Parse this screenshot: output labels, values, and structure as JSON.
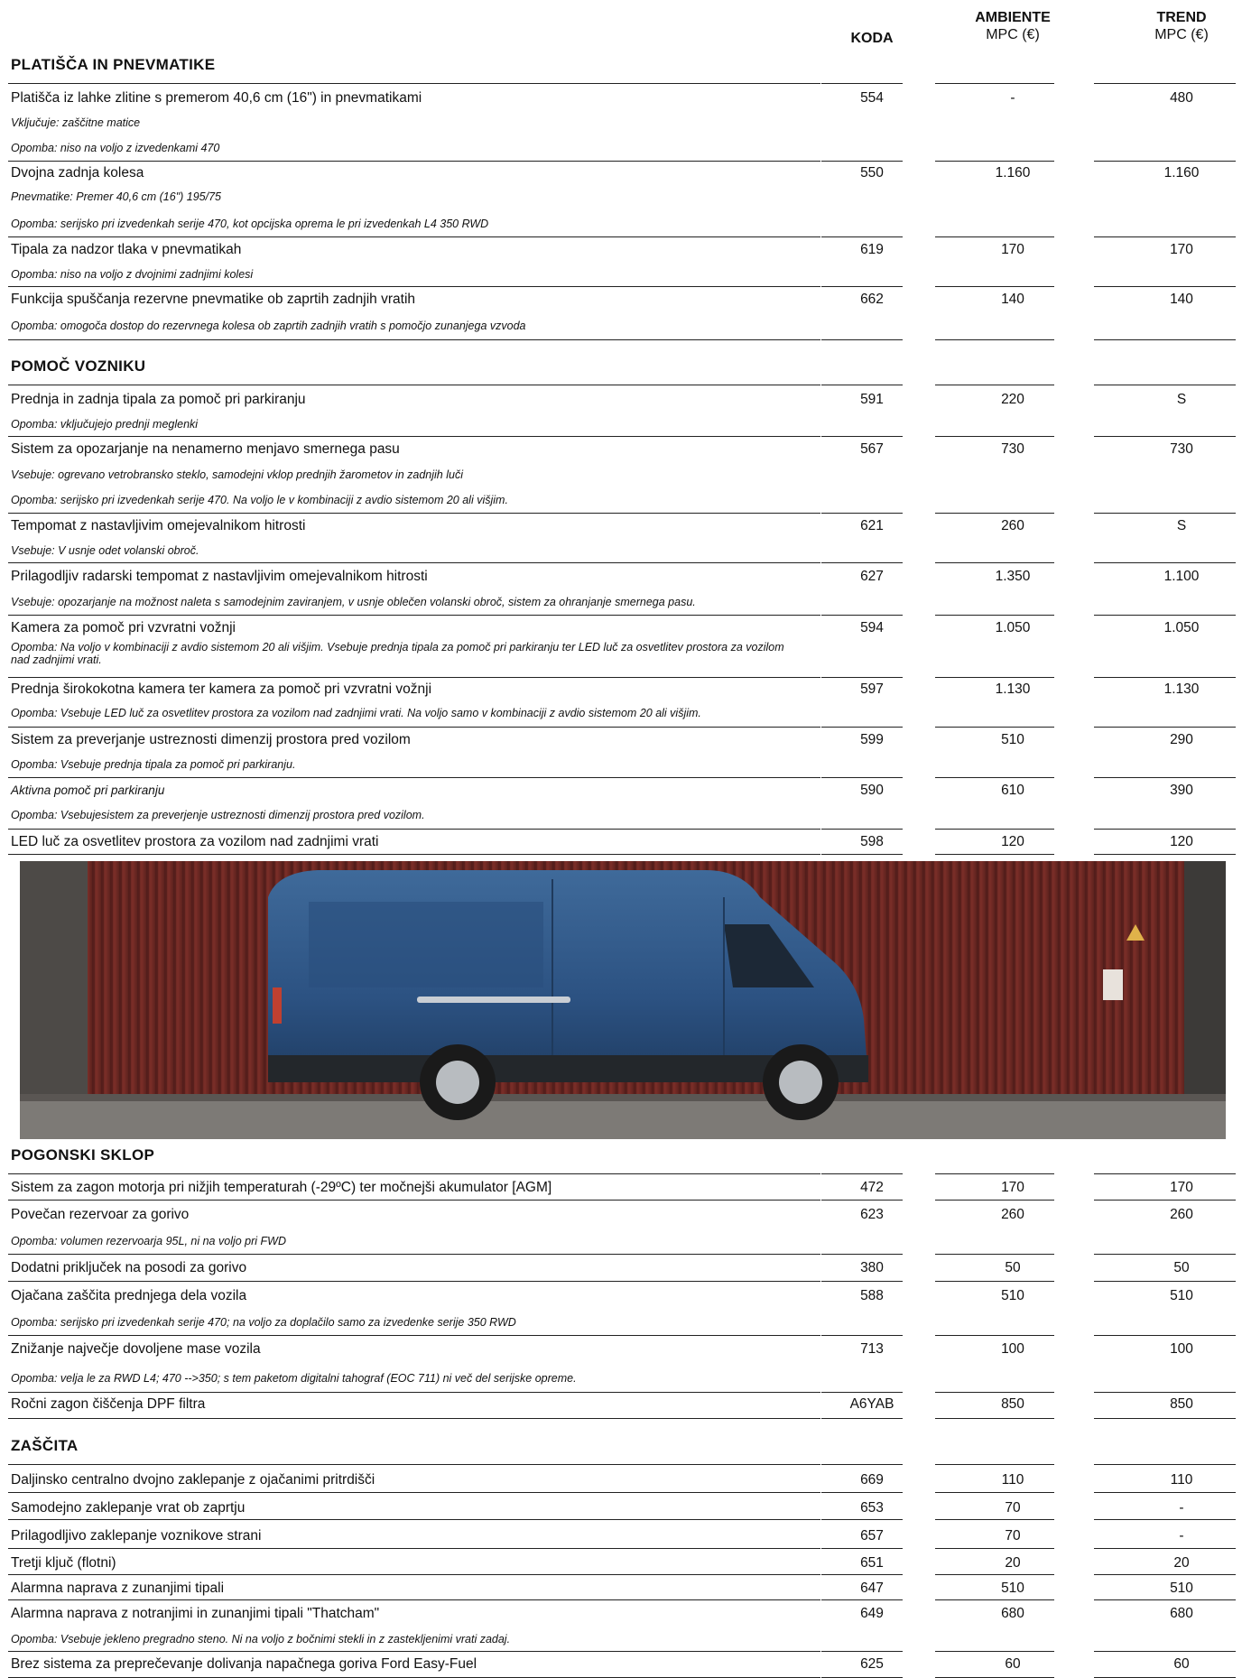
{
  "header": {
    "koda": "KODA",
    "ambiente": "AMBIENTE",
    "ambiente_sub": "MPC (€)",
    "trend": "TREND",
    "trend_sub": "MPC (€)"
  },
  "sections": [
    {
      "title": "PLATIŠČA IN PNEVMATIKE",
      "rows": [
        {
          "name": "Platišča iz lahke zlitine s premerom 40,6 cm (16\") in pnevmatikami",
          "code": "554",
          "ambiente": "-",
          "trend": "480",
          "notes": [
            "Vključuje: zaščitne matice",
            "Opomba: niso na voljo z izvedenkami 470"
          ]
        },
        {
          "name": "Dvojna zadnja kolesa",
          "code": "550",
          "ambiente": "1.160",
          "trend": "1.160",
          "notes": [
            "Pnevmatike: Premer 40,6 cm (16\") 195/75",
            "Opomba: serijsko pri izvedenkah serije 470, kot opcijska oprema le pri izvedenkah L4 350 RWD"
          ]
        },
        {
          "name": "Tipala za nadzor tlaka v pnevmatikah",
          "code": "619",
          "ambiente": "170",
          "trend": "170",
          "notes": [
            "Opomba: niso na voljo z dvojnimi zadnjimi kolesi"
          ]
        },
        {
          "name": "Funkcija spuščanja rezervne pnevmatike ob zaprtih zadnjih vratih",
          "code": "662",
          "ambiente": "140",
          "trend": "140",
          "notes": [
            "Opomba: omogoča dostop do rezervnega kolesa ob zaprtih zadnjih vratih s pomočjo zunanjega vzvoda"
          ]
        }
      ]
    },
    {
      "title": "POMOČ VOZNIKU",
      "rows": [
        {
          "name": "Prednja in zadnja tipala za pomoč pri parkiranju",
          "code": "591",
          "ambiente": "220",
          "trend": "S",
          "notes": [
            "Opomba:  vključujejo prednji meglenki"
          ]
        },
        {
          "name": "Sistem za opozarjanje na nenamerno menjavo smernega pasu",
          "code": "567",
          "ambiente": "730",
          "trend": "730",
          "notes": [
            "Vsebuje: ogrevano vetrobransko steklo, samodejni vklop prednjih žarometov in zadnjih luči",
            "Opomba: serijsko pri izvedenkah serije 470. Na voljo le v kombinaciji z avdio sistemom 20 ali višjim."
          ]
        },
        {
          "name": "Tempomat z nastavljivim omejevalnikom hitrosti",
          "code": "621",
          "ambiente": "260",
          "trend": "S",
          "notes": [
            "Vsebuje: V usnje odet volanski obroč."
          ]
        },
        {
          "name": "Prilagodljiv radarski tempomat z nastavljivim omejevalnikom hitrosti",
          "code": "627",
          "ambiente": "1.350",
          "trend": "1.100",
          "notes": [
            "Vsebuje: opozarjanje na možnost naleta s samodejnim zaviranjem, v usnje oblečen volanski obroč, sistem za ohranjanje smernega pasu."
          ]
        },
        {
          "name": "Kamera za pomoč pri vzvratni vožnji",
          "code": "594",
          "ambiente": "1.050",
          "trend": "1.050",
          "notes": [
            "Opomba: Na voljo v kombinaciji z avdio sistemom 20 ali višjim. Vsebuje prednja tipala za pomoč pri parkiranju ter LED luč za osvetlitev prostora za vozilom nad zadnjimi vrati."
          ]
        },
        {
          "name": "Prednja širokokotna kamera ter kamera za pomoč pri vzvratni vožnji",
          "code": "597",
          "ambiente": "1.130",
          "trend": "1.130",
          "notes": [
            "Opomba: Vsebuje LED luč za osvetlitev prostora za vozilom nad zadnjimi vrati. Na voljo samo v kombinaciji z avdio sistemom 20 ali višjim."
          ]
        },
        {
          "name": "Sistem za preverjanje ustreznosti dimenzij prostora pred vozilom",
          "code": "599",
          "ambiente": "510",
          "trend": "290",
          "notes": [
            "Opomba: Vsebuje prednja tipala za pomoč pri parkiranju."
          ]
        },
        {
          "name": "Aktivna pomoč pri parkiranju",
          "code": "590",
          "ambiente": "610",
          "trend": "390",
          "italic_name": true,
          "notes": [
            "Opomba: Vsebujesistem za preverjenje ustreznosti dimenzij prostora pred vozilom."
          ]
        },
        {
          "name": "LED luč za osvetlitev prostora za vozilom nad zadnjimi vrati",
          "code": "598",
          "ambiente": "120",
          "trend": "120",
          "notes": []
        }
      ]
    },
    {
      "title": "POGONSKI SKLOP",
      "rows": [
        {
          "name": "Sistem za zagon motorja pri nižjih temperaturah (-29ºC) ter močnejši akumulator [AGM]",
          "code": "472",
          "ambiente": "170",
          "trend": "170",
          "notes": []
        },
        {
          "name": "Povečan rezervoar za gorivo",
          "code": "623",
          "ambiente": "260",
          "trend": "260",
          "notes": [
            "Opomba: volumen rezervoarja 95L, ni na voljo pri FWD"
          ]
        },
        {
          "name": "Dodatni priključek na posodi za gorivo",
          "code": "380",
          "ambiente": "50",
          "trend": "50",
          "notes": []
        },
        {
          "name": "Ojačana zaščita prednjega dela vozila",
          "code": "588",
          "ambiente": "510",
          "trend": "510",
          "notes": [
            "Opomba: serijsko pri izvedenkah serije 470; na voljo za doplačilo samo za izvedenke serije 350 RWD"
          ]
        },
        {
          "name": "Znižanje največje dovoljene mase vozila",
          "code": "713",
          "ambiente": "100",
          "trend": "100",
          "notes": [
            "Opomba: velja le za RWD L4;  470 -->350; s tem paketom digitalni tahograf (EOC 711) ni več del serijske opreme."
          ]
        },
        {
          "name": "Ročni zagon čiščenja DPF filtra",
          "code": "A6YAB",
          "ambiente": "850",
          "trend": "850",
          "notes": []
        }
      ]
    },
    {
      "title": "ZAŠČITA",
      "rows": [
        {
          "name": "Daljinsko centralno dvojno zaklepanje z ojačanimi pritrdišči",
          "code": "669",
          "ambiente": "110",
          "trend": "110",
          "notes": []
        },
        {
          "name": "Samodejno zaklepanje vrat ob zaprtju",
          "code": "653",
          "ambiente": "70",
          "trend": "-",
          "notes": []
        },
        {
          "name": "Prilagodljivo zaklepanje voznikove strani",
          "code": "657",
          "ambiente": "70",
          "trend": "-",
          "notes": []
        },
        {
          "name": "Tretji ključ  (flotni)",
          "code": "651",
          "ambiente": "20",
          "trend": "20",
          "notes": []
        },
        {
          "name": "Alarmna naprava z zunanjimi tipali",
          "code": "647",
          "ambiente": "510",
          "trend": "510",
          "notes": []
        },
        {
          "name": "Alarmna naprava z notranjimi in zunanjimi tipali \"Thatcham\"",
          "code": "649",
          "ambiente": "680",
          "trend": "680",
          "notes": [
            "Opomba: Vsebuje jekleno pregradno steno. Ni na voljo z bočnimi stekli in z zastekljenimi vrati zadaj."
          ]
        },
        {
          "name": "Brez sistema za preprečevanje dolivanja napačnega goriva Ford Easy-Fuel",
          "code": "625",
          "ambiente": "60",
          "trend": "60",
          "notes": []
        }
      ]
    }
  ]
}
